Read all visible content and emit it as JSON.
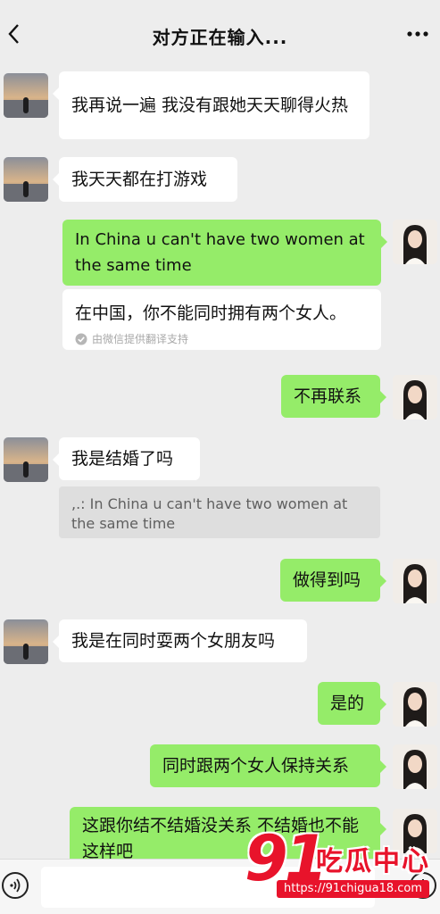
{
  "header": {
    "title": "对方正在输入...",
    "back_icon": "chevron-left-icon",
    "more_icon": "more-dots-icon"
  },
  "messages": [
    {
      "side": "left",
      "text": "我再说一遍 我没有跟她天天聊得火热"
    },
    {
      "side": "left",
      "text": "我天天都在打游戏"
    },
    {
      "side": "right",
      "text": "In China u can't have two women at the same time"
    },
    {
      "side": "right",
      "translation": "在中国，你不能同时拥有两个女人。",
      "translation_source": "由微信提供翻译支持"
    },
    {
      "side": "right",
      "text": "不再联系"
    },
    {
      "side": "left",
      "text": "我是结婚了吗",
      "quote": ",.: In China u can't have two women at the same time"
    },
    {
      "side": "right",
      "text": "做得到吗"
    },
    {
      "side": "left",
      "text": "我是在同时耍两个女朋友吗"
    },
    {
      "side": "right",
      "text": "是的"
    },
    {
      "side": "right",
      "text": "同时跟两个女人保持关系"
    },
    {
      "side": "right",
      "text": "这跟你结不结婚没关系 不结婚也不能这样吧"
    }
  ],
  "input_bar": {
    "voice_icon": "voice-icon",
    "input_value": "",
    "add_icon": "plus-icon"
  },
  "watermark": {
    "number": "91",
    "name": "吃瓜中心",
    "url": "https://91chigua18.com"
  },
  "colors": {
    "background": "#ededed",
    "bubble_green": "#95ec69",
    "bubble_white": "#ffffff",
    "watermark_red": "#e8132b"
  }
}
